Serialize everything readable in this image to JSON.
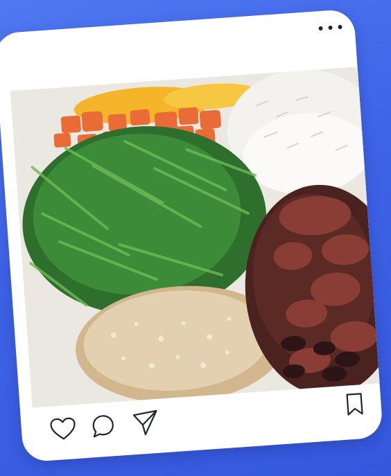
{
  "post": {
    "menu_icon": "more-horizontal-icon",
    "image_alt": "feijoada plate",
    "actions": {
      "like_icon": "heart-icon",
      "comment_icon": "comment-icon",
      "share_icon": "send-icon",
      "save_icon": "bookmark-icon"
    },
    "colors": {
      "background": "#4069e8",
      "card": "#ffffff",
      "icon": "#1f2430"
    }
  }
}
